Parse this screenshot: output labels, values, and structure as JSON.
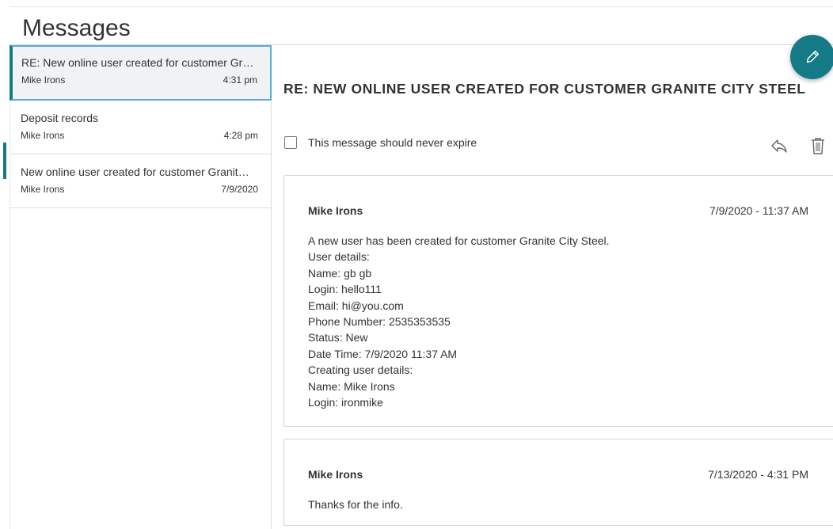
{
  "page": {
    "title": "Messages"
  },
  "messages": [
    {
      "subject": "RE: New online user created for customer Granite City Steel",
      "sender": "Mike Irons",
      "time": "4:31 pm",
      "selected": true
    },
    {
      "subject": "Deposit records",
      "sender": "Mike Irons",
      "time": "4:28 pm",
      "selected": false
    },
    {
      "subject": "New online user created for customer Granite City Steel",
      "sender": "Mike Irons",
      "time": "7/9/2020",
      "selected": false
    }
  ],
  "detail": {
    "title": "RE: NEW ONLINE USER CREATED FOR CUSTOMER GRANITE CITY STEEL",
    "never_expire_label": "This message should never expire",
    "never_expire_checked": false,
    "thread": [
      {
        "sender": "Mike Irons",
        "date": "7/9/2020 - 11:37 AM",
        "body": [
          "A new user has been created for customer Granite City Steel.",
          "User details:",
          "Name: gb gb",
          "Login: hello111",
          "Email: hi@you.com",
          "Phone Number: 2535353535",
          "Status: New",
          "Date Time: 7/9/2020 11:37 AM",
          "Creating user details:",
          "Name: Mike Irons",
          "Login: ironmike"
        ]
      },
      {
        "sender": "Mike Irons",
        "date": "7/13/2020 - 4:31 PM",
        "body": [
          "Thanks for the info."
        ]
      }
    ]
  },
  "icons": {
    "compose": "pencil-icon",
    "reply": "reply-icon",
    "delete": "trash-icon"
  },
  "colors": {
    "accent": "#137a86",
    "selected_border": "#5aa9d6",
    "selected_bg": "#f0f2f3"
  }
}
